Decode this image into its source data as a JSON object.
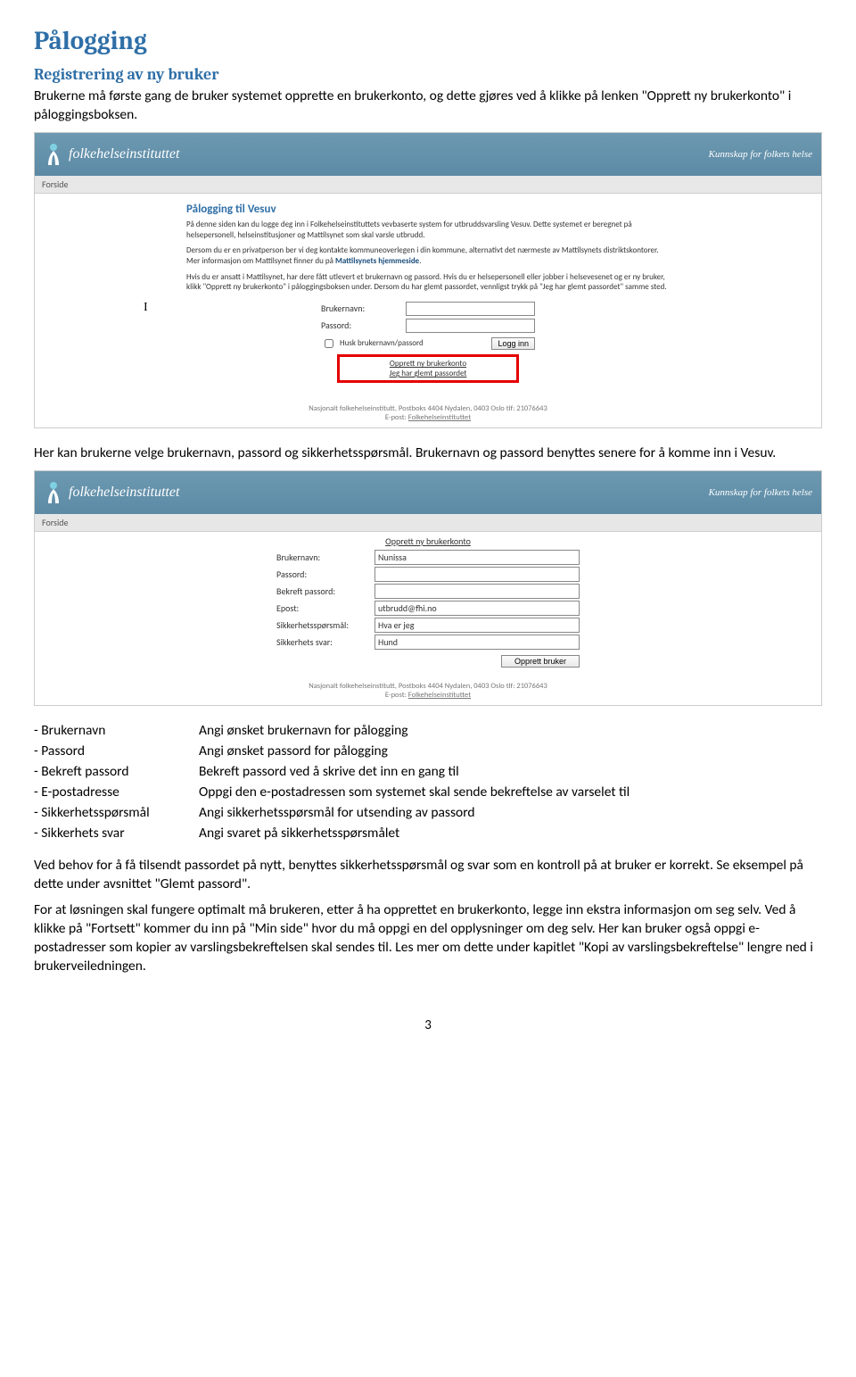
{
  "heading": "Pålogging",
  "subheading": "Registrering av ny bruker",
  "intro": "Brukerne må første gang de bruker systemet opprette en brukerkonto, og dette gjøres ved å klikke på lenken \"Opprett ny brukerkonto\" i påloggingsboksen.",
  "para2": "Her kan brukerne velge brukernavn, passord og sikkerhetsspørsmål. Brukernavn og passord benyttes senere for å komme inn i Vesuv.",
  "fields": {
    "brukernavn": {
      "term": "- Brukernavn",
      "desc": "Angi ønsket brukernavn for pålogging"
    },
    "passord": {
      "term": "- Passord",
      "desc": "Angi ønsket passord for pålogging"
    },
    "bekreft": {
      "term": "- Bekreft passord",
      "desc": "Bekreft passord ved å skrive det inn en gang til"
    },
    "epost": {
      "term": "- E-postadresse",
      "desc": "Oppgi den e-postadressen som systemet skal sende bekreftelse av varselet til"
    },
    "sporsmal": {
      "term": "- Sikkerhetsspørsmål",
      "desc": "Angi sikkerhetsspørsmål for utsending av passord"
    },
    "svar": {
      "term": "- Sikkerhets svar",
      "desc": "Angi svaret på sikkerhetsspørsmålet"
    }
  },
  "para3": "Ved behov for å få tilsendt passordet på nytt, benyttes sikkerhetsspørsmål og svar som en kontroll på at bruker er korrekt. Se eksempel på dette under avsnittet \"Glemt passord\".",
  "para4": "For at løsningen skal fungere optimalt må brukeren, etter å ha opprettet en brukerkonto, legge inn ekstra informasjon om seg selv. Ved å klikke på \"Fortsett\" kommer du inn på \"Min side\" hvor du må oppgi en del opplysninger om deg selv. Her kan bruker også oppgi e-postadresser som kopier av varslingsbekreftelsen skal sendes til. Les mer om dette under kapitlet \"Kopi av varslingsbekreftelse\" lengre ned i brukerveiledningen.",
  "page_num": "3",
  "ss1": {
    "logo_text": "folkehelseinstituttet",
    "slogan": "Kunnskap for folkets helse",
    "nav": "Forside",
    "title": "Pålogging til Vesuv",
    "p1a": "På denne siden kan du logge deg inn i Folkehelseinstituttets vevbaserte system for utbruddsvarsling Vesuv. Dette systemet er beregnet på helsepersonell, helseinstitusjoner og Mattilsynet som skal varsle utbrudd.",
    "p2a": "Dersom du er en privatperson ber vi deg kontakte kommuneoverlegen i din kommune, alternativt det nærmeste av Mattilsynets distriktskontorer. Mer informasjon om Mattilsynet finner du på ",
    "p2b": "Mattilsynets hjemmeside",
    "p2c": ".",
    "p3": "Hvis du er ansatt i Mattilsynet, har dere fått utlevert et brukernavn og passord. Hvis du er helsepersonell eller jobber i helsevesenet og er ny bruker, klikk \"Opprett ny brukerkonto\" i påloggingsboksen under. Dersom du har glemt passordet, vennligst trykk på \"Jeg har glemt passordet\" samme sted.",
    "lbl_user": "Brukernavn:",
    "lbl_pass": "Passord:",
    "chk": "Husk brukernavn/passord",
    "btn_login": "Logg inn",
    "link1": "Opprett ny brukerkonto",
    "link2": "Jeg har glemt passordet",
    "footer1": "Nasjonalt folkehelseinstitutt, Postboks 4404 Nydalen, 0403 Oslo    tlf: 21076643",
    "footer2a": "E-post: ",
    "footer2b": "Folkehelseinstituttet"
  },
  "ss2": {
    "title": "Opprett ny brukerkonto",
    "lbl_user": "Brukernavn:",
    "val_user": "Nunissa",
    "lbl_pass": "Passord:",
    "lbl_bekreft": "Bekreft passord:",
    "lbl_epost": "Epost:",
    "val_epost": "utbrudd@fhi.no",
    "lbl_sporsmal": "Sikkerhetsspørsmål:",
    "val_sporsmal": "Hva er jeg",
    "lbl_svar": "Sikkerhets svar:",
    "val_svar": "Hund",
    "btn_create": "Opprett bruker"
  }
}
